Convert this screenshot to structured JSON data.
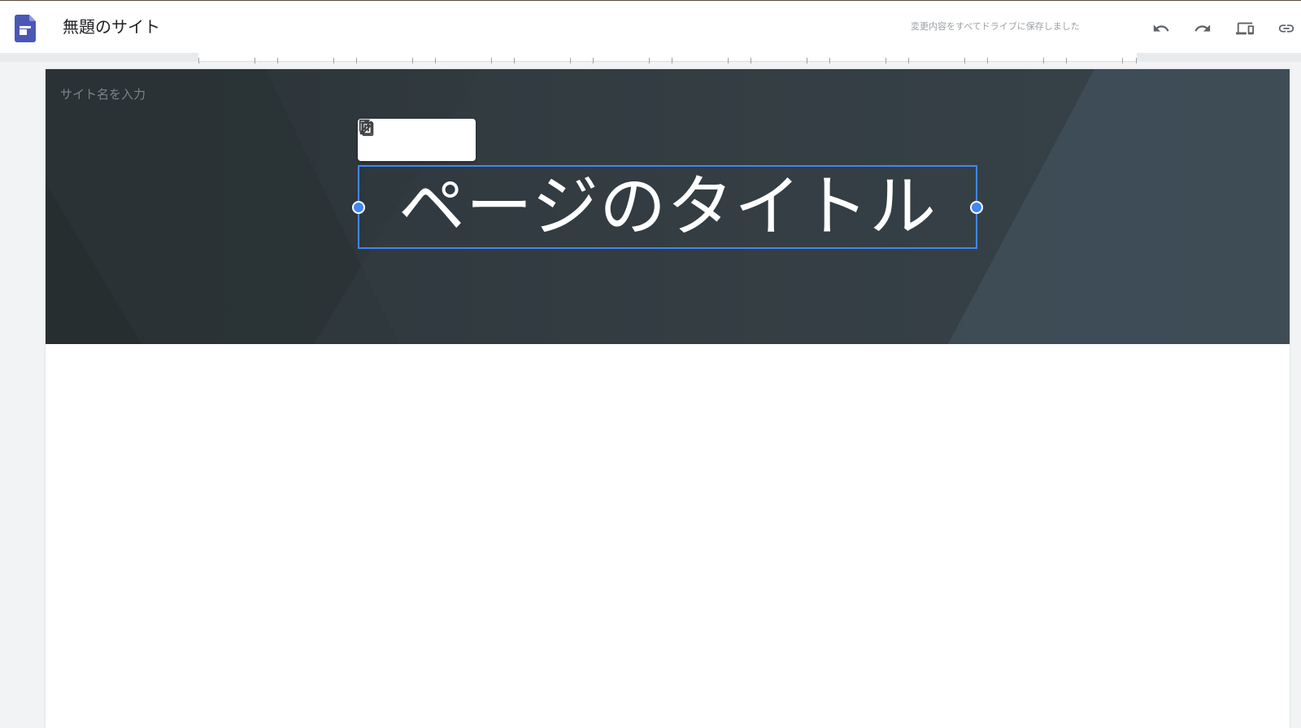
{
  "appbar": {
    "title": "無題のサイト",
    "save_status": "変更内容をすべてドライブに保存しました",
    "icons": {
      "logo": "google-sites-logo",
      "undo": "undo-icon",
      "redo": "redo-icon",
      "preview": "preview-devices-icon",
      "link": "link-icon"
    },
    "logo_color": "#4b57b6"
  },
  "header": {
    "site_name_placeholder": "サイト名を入力",
    "page_title": "ページのタイトル",
    "toolbar": {
      "icons": [
        "edit-icon",
        "duplicate-icon",
        "delete-icon"
      ]
    },
    "background_color": "#2c3438",
    "selection_color": "#4285f4"
  }
}
